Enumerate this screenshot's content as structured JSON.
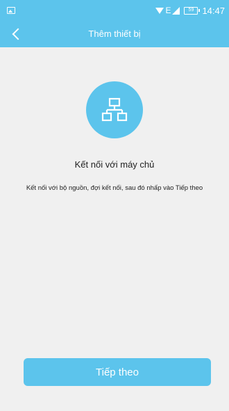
{
  "status_bar": {
    "network_label": "E",
    "battery": "59",
    "time": "14:47"
  },
  "header": {
    "title": "Thêm thiết bị"
  },
  "main": {
    "heading": "Kết nối với máy chủ",
    "description": "Kết nối với bộ nguồn, đợi kết nối, sau đó nhấp vào Tiếp theo",
    "next_button_label": "Tiếp theo"
  },
  "icons": {
    "status_left": "image-icon",
    "wifi": "wifi-icon",
    "signal": "signal-icon",
    "battery": "battery-icon",
    "back": "back-arrow-icon",
    "server": "network-topology-icon"
  },
  "colors": {
    "accent": "#5cc4ec",
    "background": "#f0f0f0",
    "text": "#222222"
  }
}
